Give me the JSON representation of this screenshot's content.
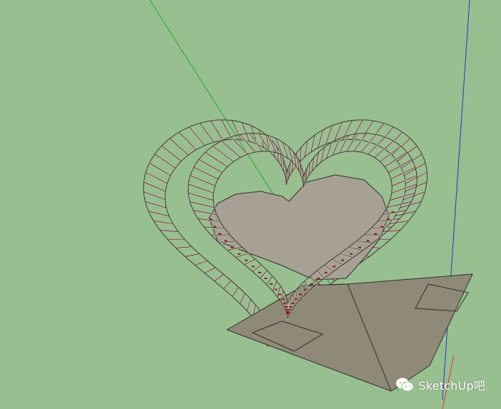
{
  "viewport": {
    "background_color": "#97bf90",
    "green_axis_color": "#2aa52a",
    "blue_axis_color": "#2d35c8",
    "red_axis_color": "#d23a2a"
  },
  "model": {
    "slat_color": "#b9b39f",
    "slat_edge_color": "#34302a",
    "floor_color": "#a7a094",
    "deck_color": "#8f8a78",
    "accent_color": "#8a1d16"
  },
  "watermark": {
    "icon": "wechat-icon",
    "text": "SketchUp吧"
  }
}
